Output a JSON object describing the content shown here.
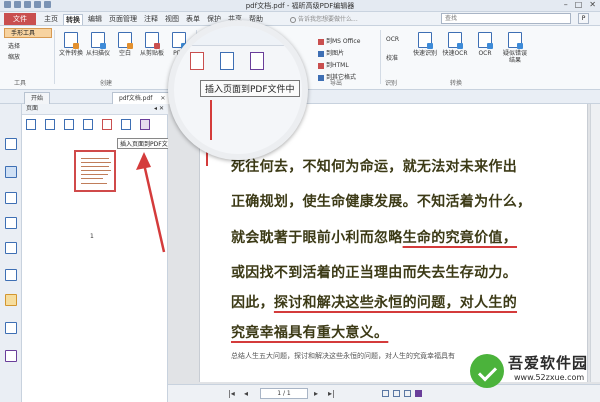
{
  "window": {
    "title": "pdf文档.pdf - 福昕高级PDF编辑器",
    "controls": [
      "minimize-icon",
      "maximize-icon",
      "close-icon"
    ]
  },
  "menubar": {
    "file": "文件",
    "items": [
      "主页",
      "转换",
      "编辑",
      "页面管理",
      "注释",
      "视图",
      "表单",
      "保护",
      "共享",
      "帮助"
    ],
    "active_index": 1,
    "help_search": "告诉我您想要做什么...",
    "search_placeholder": "查找",
    "search_button": "P"
  },
  "ribbon": {
    "hand_tool": "手形工具",
    "select": "选择",
    "zoom": "缩放",
    "tools_group": "工具",
    "buttons": [
      {
        "label": "文件转换",
        "icon": "file-convert-icon"
      },
      {
        "label": "从扫描仪",
        "icon": "scanner-icon"
      },
      {
        "label": "空白",
        "icon": "blank-page-icon"
      },
      {
        "label": "从剪贴板",
        "icon": "clipboard-icon"
      },
      {
        "label": "PDF",
        "icon": "pdf-icon"
      }
    ],
    "create_group": "创建",
    "export_list": [
      "到MS Office",
      "到图片",
      "到HTML",
      "到其它格式"
    ],
    "export_group": "导出",
    "ocr_buttons": [
      {
        "label": "快速识别",
        "icon": "quick-recognize-icon"
      },
      {
        "label": "快速OCR",
        "icon": "quick-ocr-icon"
      },
      {
        "label": "OCR",
        "icon": "ocr-icon"
      },
      {
        "label": "疑似错误结果",
        "icon": "suspect-result-icon"
      }
    ],
    "convert_group": "转换",
    "recognize_group": "识别",
    "secondary_list": [
      "OCR",
      "校准"
    ]
  },
  "magnifier": {
    "tooltip": "插入页面到PDF文件中",
    "icons": [
      "insert-page-icon",
      "extract-page-icon",
      "flag-page-icon"
    ]
  },
  "tabs": {
    "start": "开始",
    "doc": "pdf文档.pdf"
  },
  "panel": {
    "title": "页面",
    "collapse": "◂",
    "close": "✕",
    "tooltip": "插入页面到PDF文件中",
    "thumb_number": "1"
  },
  "document": {
    "lines": [
      "死往何去，不知何为命运，就无法对未来作出",
      "正确规划，使生命健康发展。不知活着为什么，",
      "就会耽著于眼前小利而忽略",
      "生命的究竟价值，",
      "或因找不到活着的正当理由而失去生存动力。",
      "因此，",
      "探讨和解决这些永恒的问题，对人生的",
      "究竟幸福具有重大意义。"
    ],
    "footnote": "总结人生五大问题，探讨和解决这些永恒的问题，对人生的究竟幸福具有"
  },
  "navbar": {
    "page_field": "1 / 1",
    "first": "|◂",
    "prev": "◂",
    "next": "▸",
    "last": "▸|"
  },
  "watermark": {
    "name": "吾爱软件园",
    "url": "www.52zxue.com"
  },
  "colors": {
    "accent_red": "#d43b3b",
    "file_menu": "#c94f4f",
    "text_body": "#3c3a16"
  }
}
